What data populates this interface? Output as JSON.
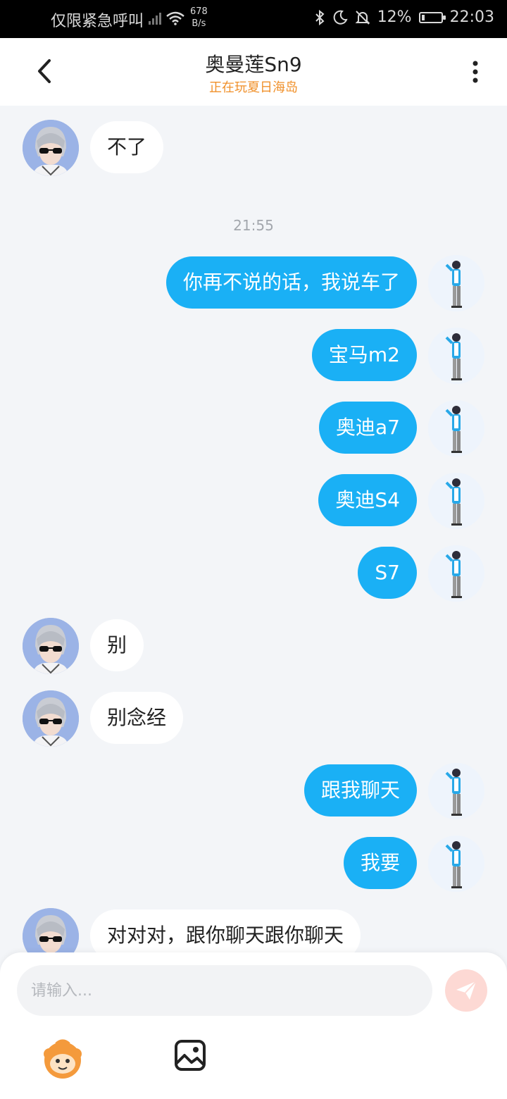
{
  "status_bar": {
    "carrier": "仅限紧急呼叫",
    "speed_value": "678",
    "speed_unit": "B/s",
    "battery": "12%",
    "time": "22:03"
  },
  "header": {
    "title": "奥曼莲Sn9",
    "subtitle": "正在玩夏日海岛"
  },
  "messages": [
    {
      "side": "left",
      "text": "不了"
    },
    {
      "type": "time",
      "text": "21:55"
    },
    {
      "side": "right",
      "text": "你再不说的话，我说车了"
    },
    {
      "side": "right",
      "text": "宝马m2"
    },
    {
      "side": "right",
      "text": "奥迪a7"
    },
    {
      "side": "right",
      "text": "奥迪S4"
    },
    {
      "side": "right",
      "text": "S7"
    },
    {
      "side": "left",
      "text": "别"
    },
    {
      "side": "left",
      "text": "别念经"
    },
    {
      "side": "right",
      "text": "跟我聊天"
    },
    {
      "side": "right",
      "text": "我要"
    },
    {
      "side": "left",
      "text": "对对对，跟你聊天跟你聊天"
    }
  ],
  "input": {
    "placeholder": "请输入..."
  },
  "colors": {
    "accent": "#1ab0f5",
    "subtitle": "#f0902a"
  }
}
